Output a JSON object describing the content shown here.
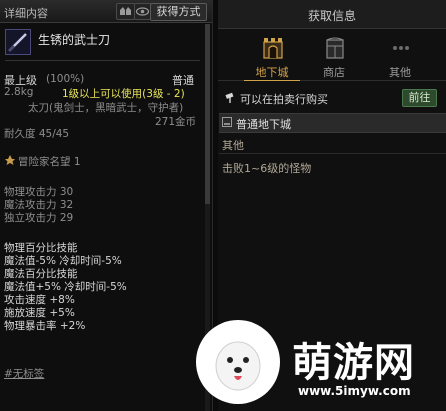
{
  "left_panel": {
    "title": "详细内容",
    "gain_button": "获得方式",
    "item": {
      "name": "生锈的武士刀",
      "grade": "最上级",
      "grade_pct": "(100%)",
      "rarity": "普通",
      "weight": "2.8kg",
      "usable": "1级以上可以使用(3级 - 2)",
      "classes": "太刀(鬼剑士，黑暗武士，守护者)",
      "price": "271金币",
      "durability": "耐久度 45/45",
      "fame": "冒险家名望 1",
      "stats": [
        "物理攻击力 30",
        "魔法攻击力 32",
        "独立攻击力 29"
      ],
      "skills": [
        {
          "text": "物理百分比技能",
          "color": "w"
        },
        {
          "text": " 魔法值-5% 冷却时间-5%",
          "color": "w"
        },
        {
          "text": "魔法百分比技能",
          "color": "w"
        },
        {
          "text": " 魔法值+5% 冷却时间-5%",
          "color": "w"
        },
        {
          "text": "攻击速度 +8%",
          "color": "w"
        },
        {
          "text": "施放速度 +5%",
          "color": "w"
        },
        {
          "text": "物理暴击率 +2%",
          "color": "w"
        }
      ],
      "tag": "#无标签"
    }
  },
  "right_panel": {
    "title": "获取信息",
    "tabs": [
      {
        "label": "地下城",
        "icon": "dungeon-gate-icon",
        "active": true
      },
      {
        "label": "商店",
        "icon": "shop-cabinet-icon",
        "active": false
      },
      {
        "label": "其他",
        "icon": "more-dots-icon",
        "active": false
      }
    ],
    "auction_text": "可以在拍卖行购买",
    "go_button": "前往",
    "section_title": "普通地下城",
    "other_label": "其他",
    "defeat_text": "击败1~6级的怪物"
  },
  "watermark": {
    "text": "萌游网",
    "url": "www.5imyw.com"
  },
  "colors": {
    "accent_gold": "#d0a24a",
    "yellow_text": "#e8e45a",
    "go_green": "#2e4a2e"
  }
}
